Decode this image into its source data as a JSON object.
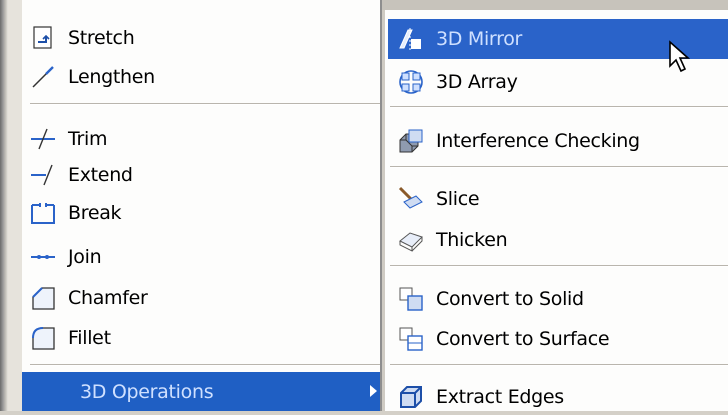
{
  "modify_menu": {
    "items": [
      {
        "label": "Stretch",
        "icon": "stretch-icon"
      },
      {
        "label": "Lengthen",
        "icon": "lengthen-icon"
      },
      {
        "label": "Trim",
        "icon": "trim-icon"
      },
      {
        "label": "Extend",
        "icon": "extend-icon"
      },
      {
        "label": "Break",
        "icon": "break-icon"
      },
      {
        "label": "Join",
        "icon": "join-icon"
      },
      {
        "label": "Chamfer",
        "icon": "chamfer-icon"
      },
      {
        "label": "Fillet",
        "icon": "fillet-icon"
      },
      {
        "label": "3D Operations",
        "icon": "submenu-arrow-icon",
        "highlighted": true
      }
    ]
  },
  "ops_submenu": {
    "items": [
      {
        "label": "3D Mirror",
        "icon": "mirror-3d-icon",
        "highlighted": true
      },
      {
        "label": "3D Array",
        "icon": "array-3d-icon"
      },
      {
        "label": "Interference Checking",
        "icon": "interference-icon"
      },
      {
        "label": "Slice",
        "icon": "slice-icon"
      },
      {
        "label": "Thicken",
        "icon": "thicken-icon"
      },
      {
        "label": "Convert to Solid",
        "icon": "convert-solid-icon"
      },
      {
        "label": "Convert to Surface",
        "icon": "convert-surface-icon"
      },
      {
        "label": "Extract Edges",
        "icon": "extract-edges-icon"
      }
    ]
  },
  "colors": {
    "menu_bg": "#fdfdfc",
    "highlight": "#1f5fc4",
    "icon_blue": "#2a5fb0"
  }
}
